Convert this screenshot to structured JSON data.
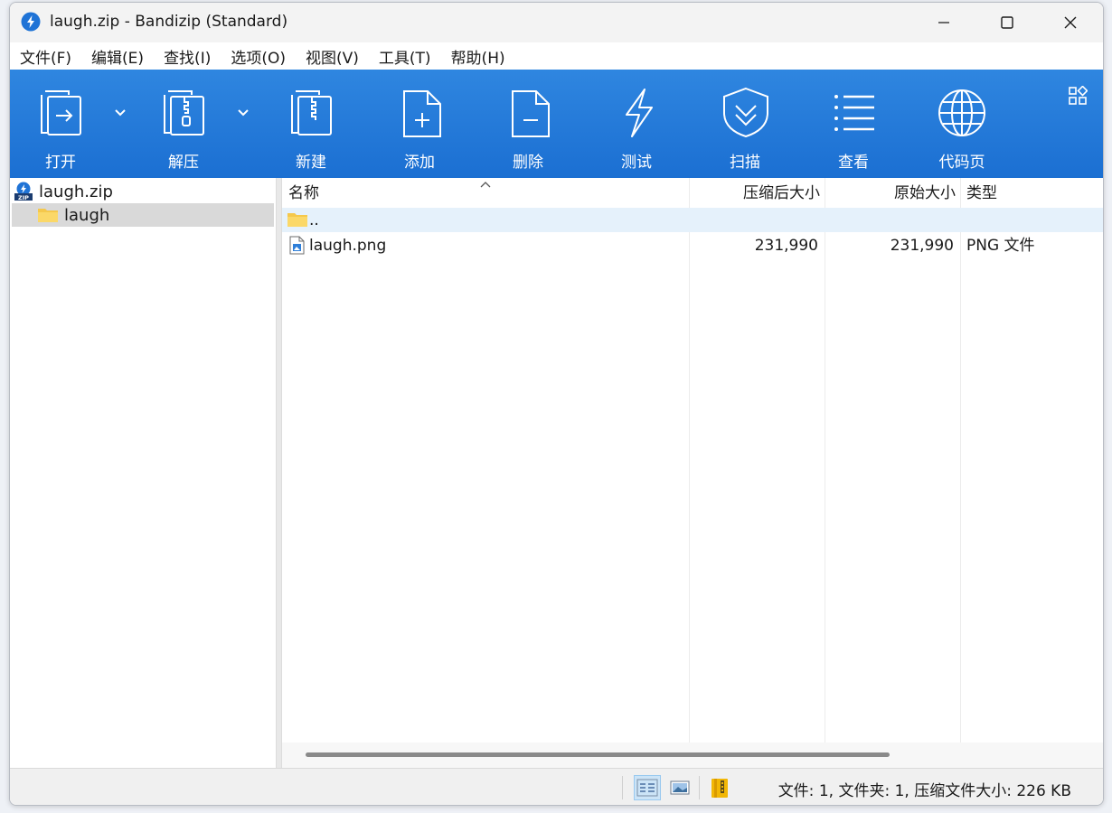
{
  "window": {
    "title": "laugh.zip - Bandizip (Standard)"
  },
  "menu": [
    "文件(F)",
    "编辑(E)",
    "查找(I)",
    "选项(O)",
    "视图(V)",
    "工具(T)",
    "帮助(H)"
  ],
  "toolbar": {
    "open": "打开",
    "extract": "解压",
    "new": "新建",
    "add": "添加",
    "delete": "删除",
    "test": "测试",
    "scan": "扫描",
    "view": "查看",
    "codepage": "代码页"
  },
  "tree": {
    "root": "laugh.zip",
    "child": "laugh"
  },
  "columns": {
    "name": "名称",
    "compressed": "压缩后大小",
    "original": "原始大小",
    "type": "类型"
  },
  "files": [
    {
      "name": "..",
      "compressed": "",
      "original": "",
      "type": ""
    },
    {
      "name": "laugh.png",
      "compressed": "231,990",
      "original": "231,990",
      "type": "PNG 文件"
    }
  ],
  "status": {
    "text": "文件: 1, 文件夹: 1, 压缩文件大小: 226 KB"
  },
  "colors": {
    "toolbar_top": "#2f86e0",
    "toolbar_bottom": "#1b6fd2",
    "selected_tree": "#d9d9d9",
    "row_highlight": "#e5f1fb"
  }
}
